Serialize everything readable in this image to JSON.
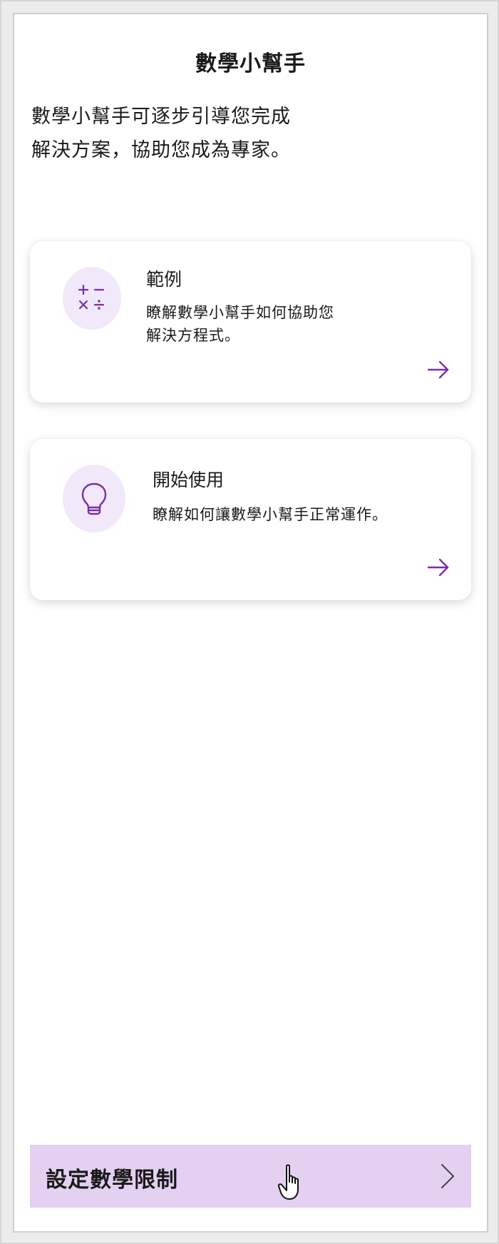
{
  "header": {
    "title": "數學小幫手"
  },
  "intro": {
    "line1": "數學小幫手可逐步引導您完成",
    "line2": "解決方案，協助您成為專家。"
  },
  "cards": [
    {
      "title": "範例",
      "desc_line1": "瞭解數學小幫手如何協助您",
      "desc_line2": "解決方程式。",
      "icon": "math-operators-icon"
    },
    {
      "title": "開始使用",
      "desc_line1": "瞭解如何讓數學小幫手正常運作。",
      "desc_line2": "",
      "icon": "lightbulb-icon"
    }
  ],
  "footer": {
    "limits_label": "設定數學限制",
    "chevron_icon": "chevron-right-icon"
  },
  "colors": {
    "accent": "#7a2fa8",
    "icon_bg": "#f1e8f9",
    "bar_bg": "#e4d0f0"
  }
}
